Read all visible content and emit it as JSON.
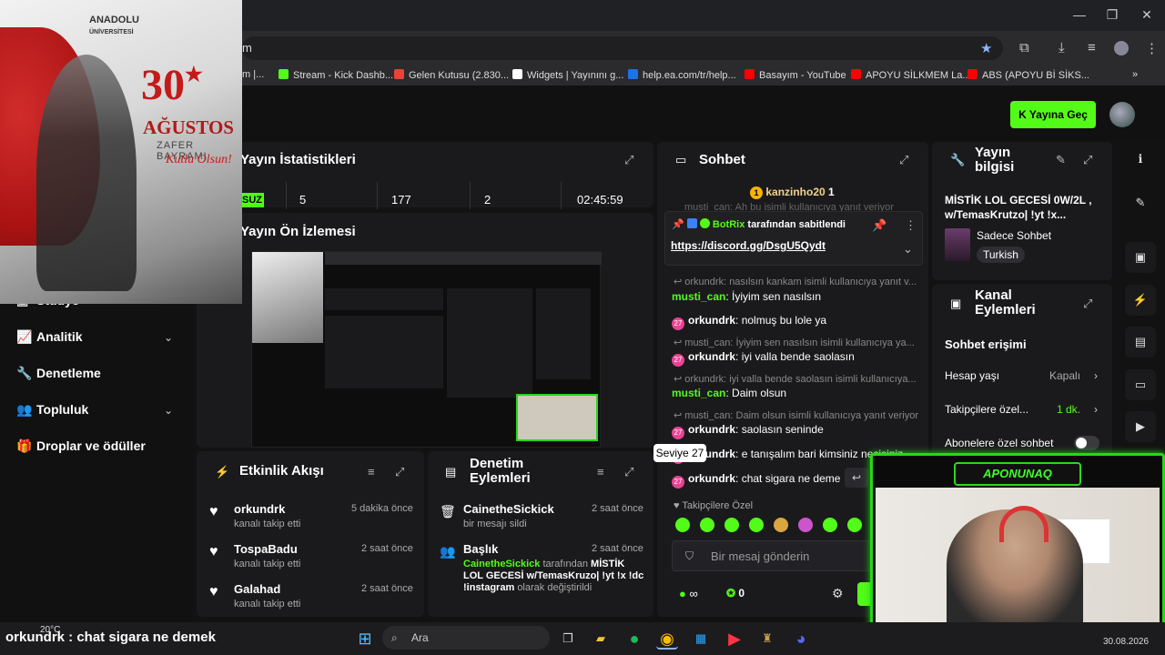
{
  "browser": {
    "url": "m",
    "bookmarks": [
      {
        "label": "m |...",
        "color": "#666"
      },
      {
        "label": "Stream - Kick Dashb...",
        "color": "#53fc18"
      },
      {
        "label": "Gelen Kutusu (2.830...",
        "color": "#ea4335"
      },
      {
        "label": "Widgets | Yayınını g...",
        "color": "#fff"
      },
      {
        "label": "help.ea.com/tr/help...",
        "color": "#1a73e8"
      },
      {
        "label": "Basayım - YouTube",
        "color": "#ff0000"
      },
      {
        "label": "APOYU SİLKMEM La...",
        "color": "#ff0000"
      },
      {
        "label": "ABS (APOYU Bİ SİKS...",
        "color": "#ff0000"
      }
    ],
    "more": "»"
  },
  "header": {
    "go_live": "Yayına Geç"
  },
  "nav": {
    "items": [
      {
        "label": "Stüdyo",
        "icon": "studio-icon"
      },
      {
        "label": "Analitik",
        "icon": "chart-icon",
        "expand": true
      },
      {
        "label": "Denetleme",
        "icon": "wrench-icon"
      },
      {
        "label": "Topluluk",
        "icon": "users-icon",
        "expand": true
      },
      {
        "label": "Droplar ve ödüller",
        "icon": "gift-icon"
      }
    ]
  },
  "stats": {
    "title": "Yayın İstatistikleri",
    "status": "SUZ",
    "v1": "5",
    "v2": "177",
    "v3": "2",
    "duration": "02:45:59"
  },
  "preview": {
    "title": "Yayın Ön İzlemesi"
  },
  "chat": {
    "title": "Sohbet",
    "top_gifter": "kanzinho20",
    "top_gifter_count": "1",
    "ghost_line": "musti_can: Ah bu isimli kullanıcıya yanıt veriyor",
    "pinned_by": "BotRix",
    "pinned_by_suffix": "tarafından sabitlendi",
    "pinned_link": "https://discord.gg/DsgU5Qydt",
    "messages": [
      {
        "type": "reply",
        "text": "orkundrk: nasılsın kankam isimli kullanıcıya yanıt v..."
      },
      {
        "type": "msg",
        "user": "musti_can",
        "text": "İyiyim sen nasılsın",
        "green": true
      },
      {
        "type": "msg",
        "user": "orkundrk",
        "text": "nolmuş bu lole ya",
        "badge": "27"
      },
      {
        "type": "reply",
        "text": "musti_can: İyiyim sen nasılsın isimli kullanıcıya ya..."
      },
      {
        "type": "msg",
        "user": "orkundrk",
        "text": "iyi valla bende saolasın",
        "badge": "27"
      },
      {
        "type": "reply",
        "text": "orkundrk: iyi valla bende saolasın isimli kullanıcıya..."
      },
      {
        "type": "msg",
        "user": "musti_can",
        "text": "Daim olsun",
        "green": true
      },
      {
        "type": "reply",
        "text": "musti_can: Daim olsun isimli kullanıcıya yanıt veriyor"
      },
      {
        "type": "msg",
        "user": "orkundrk",
        "text": "saolasın seninde",
        "badge": "27"
      },
      {
        "type": "msg",
        "user": "orkundrk",
        "text": "e tanışalım bari kimsiniz necisiniz",
        "badge": "27"
      },
      {
        "type": "msg",
        "user": "orkundrk",
        "text": "chat sigara ne deme",
        "badge": "27"
      }
    ],
    "tooltip": "Seviye 27",
    "followers_only": "Takipçilere Özel",
    "input_placeholder": "Bir mesaj gönderin",
    "viewers_count": "0",
    "infinity": "∞"
  },
  "stream_info": {
    "title": "Yayın bilgisi",
    "stream_title": "MİSTİK LOL GECESİ 0W/2L , w/TemasKrutzo| !yt !x...",
    "category": "Sadece Sohbet",
    "language": "Turkish"
  },
  "channel_actions": {
    "title": "Kanal Eylemleri",
    "section": "Sohbet erişimi",
    "rows": [
      {
        "label": "Hesap yaşı",
        "value": "Kapalı"
      },
      {
        "label": "Takipçilere özel...",
        "value": "1 dk."
      },
      {
        "label": "Abonelere özel sohbet",
        "value": ""
      }
    ]
  },
  "activity": {
    "title": "Etkinlik Akışı",
    "items": [
      {
        "name": "orkundrk",
        "sub": "kanalı takip etti",
        "time": "5 dakika önce"
      },
      {
        "name": "TospaBadu",
        "sub": "kanalı takip etti",
        "time": "2 saat önce"
      },
      {
        "name": "Galahad",
        "sub": "kanalı takip etti",
        "time": "2 saat önce"
      }
    ]
  },
  "mod_actions": {
    "title": "Denetim Eylemleri",
    "items": [
      {
        "name": "CainetheSickick",
        "sub": "bir mesajı sildi",
        "time": "2 saat önce"
      },
      {
        "name": "Başlık",
        "sub_user": "CainetheSickick",
        "sub_mid": "tarafından",
        "sub_bold": "MİSTİK LOL GECESİ w/TemasKruzo| !yt !x !dc !instagram",
        "sub_end": "olarak değiştirildi",
        "time": "2 saat önce"
      }
    ]
  },
  "overlay": {
    "poster_brand": "ANADOLU",
    "poster_brand_sub": "ÜNİVERSİTESİ",
    "poster_number": "30",
    "poster_month": "AĞUSTOS",
    "poster_holiday": "ZAFER BAYRAMI",
    "poster_greeting": "Kutlu Olsun!",
    "cam_tag": "APONUNAQ",
    "subtitle": "orkundrk : chat sigara ne demek"
  },
  "taskbar": {
    "search": "Ara",
    "weather": "20°C",
    "date": "30.08.2026"
  }
}
